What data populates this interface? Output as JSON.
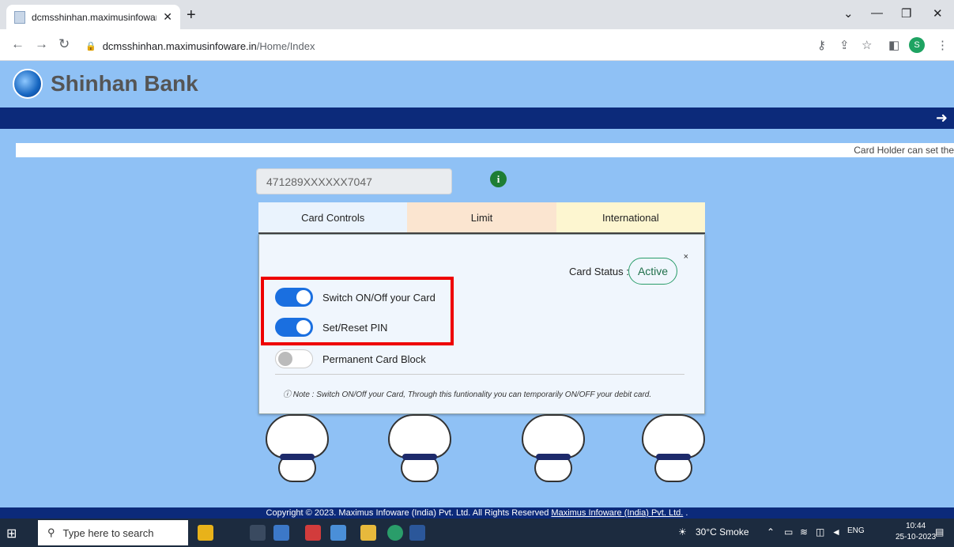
{
  "browser": {
    "tab_title": "dcmsshinhan.maximusinfoware.in/",
    "new_tab": "+",
    "url_host": "dcmsshinhan.maximusinfoware.in",
    "url_path": "/Home/Index",
    "profile_initial": "S"
  },
  "bank": {
    "name": "Shinhan Bank",
    "marquee_text": "Card Holder can set the"
  },
  "card": {
    "number": "471289XXXXXX7047"
  },
  "tabs": [
    {
      "label": "Card Controls"
    },
    {
      "label": "Limit"
    },
    {
      "label": "International"
    }
  ],
  "panel": {
    "status_label": "Card Status :",
    "status_value": "Active",
    "close": "×",
    "toggles": [
      {
        "label": "Switch ON/Off your Card",
        "state": "on"
      },
      {
        "label": "Set/Reset PIN",
        "state": "on"
      },
      {
        "label": "Permanent Card Block",
        "state": "off"
      }
    ],
    "note": "ⓘ Note : Switch ON/Off your Card, Through this funtionality you can temporarily ON/OFF your debit card."
  },
  "footer": {
    "text": "Copyright © 2023. Maximus Infoware (India) Pvt. Ltd. All Rights Reserved",
    "link": "Maximus Infoware (India) Pvt. Ltd.",
    "tail": " ."
  },
  "taskbar": {
    "search_placeholder": "Type here to search",
    "weather": "30°C Smoke",
    "lang": "ENG",
    "time": "10:44",
    "date": "25-10-2023"
  },
  "colors": {
    "page_bg": "#8fc1f5",
    "nav_band": "#0c2a7a",
    "toggle_on": "#1a6fe0",
    "highlight": "#e00000"
  }
}
